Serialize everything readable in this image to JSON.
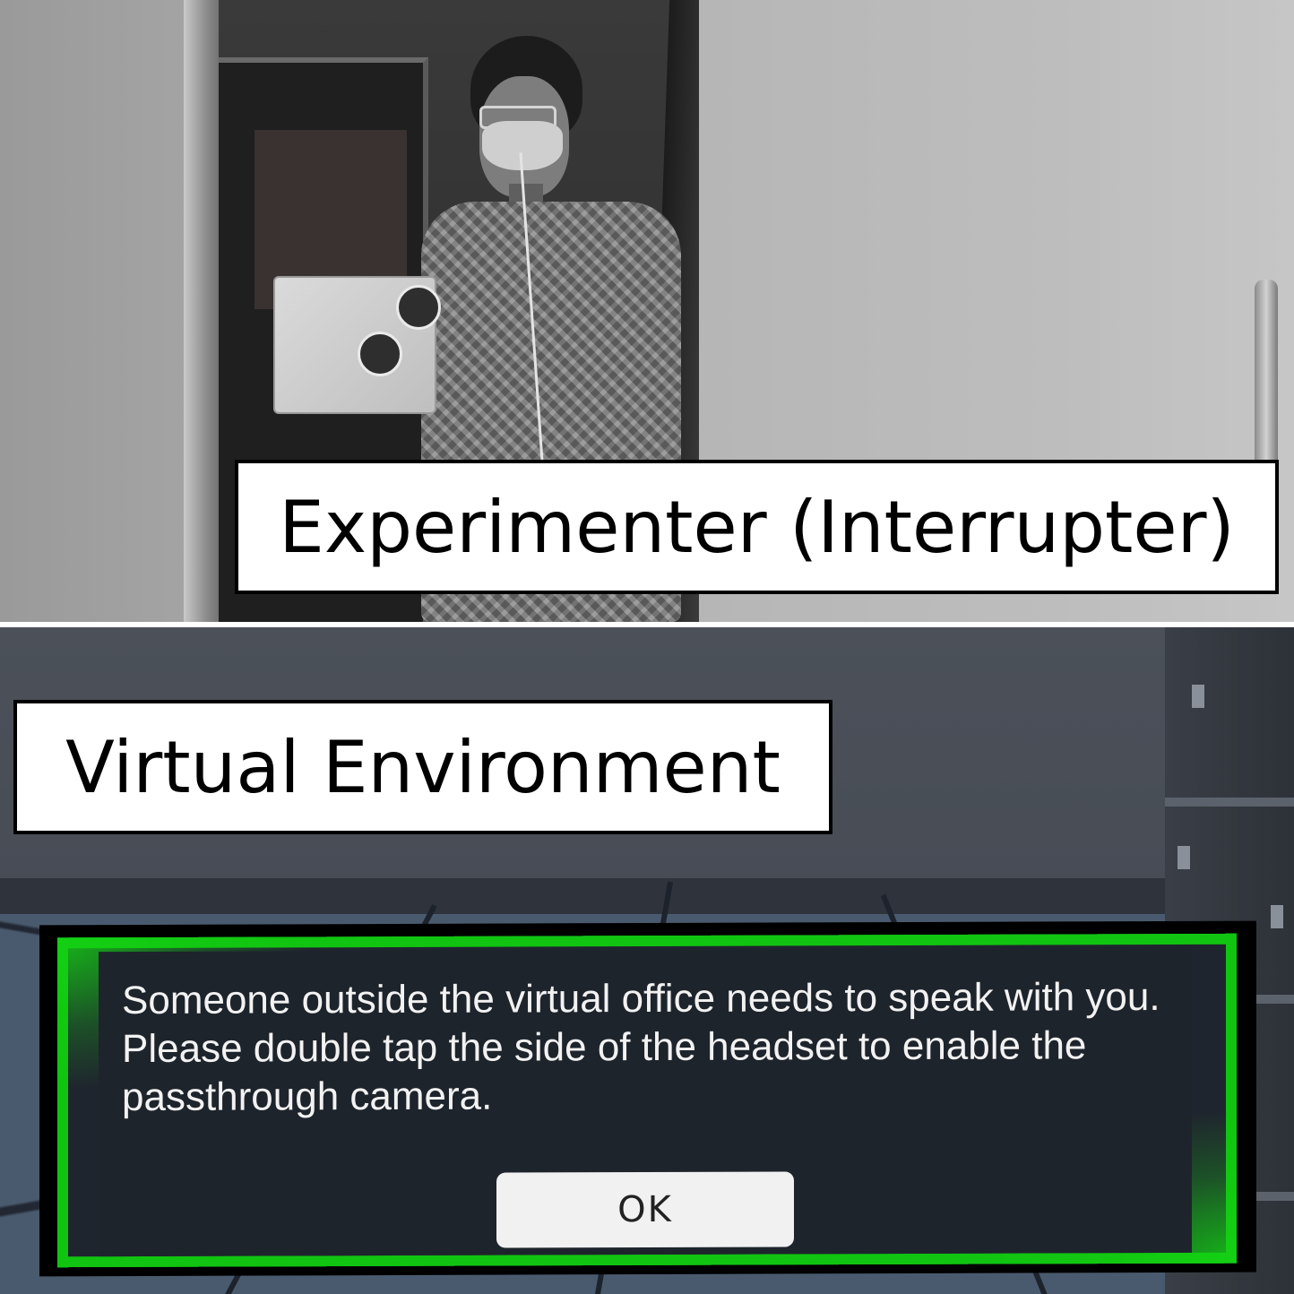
{
  "top_view": {
    "label": "Experimenter (Interrupter)"
  },
  "bottom_view": {
    "label": "Virtual Environment",
    "dialog": {
      "message": "Someone outside the virtual office needs to speak with you. Please double tap the side of the headset to enable the passthrough camera.",
      "ok_label": "OK",
      "border_color": "#11c411",
      "background_color": "#1e242c"
    }
  }
}
